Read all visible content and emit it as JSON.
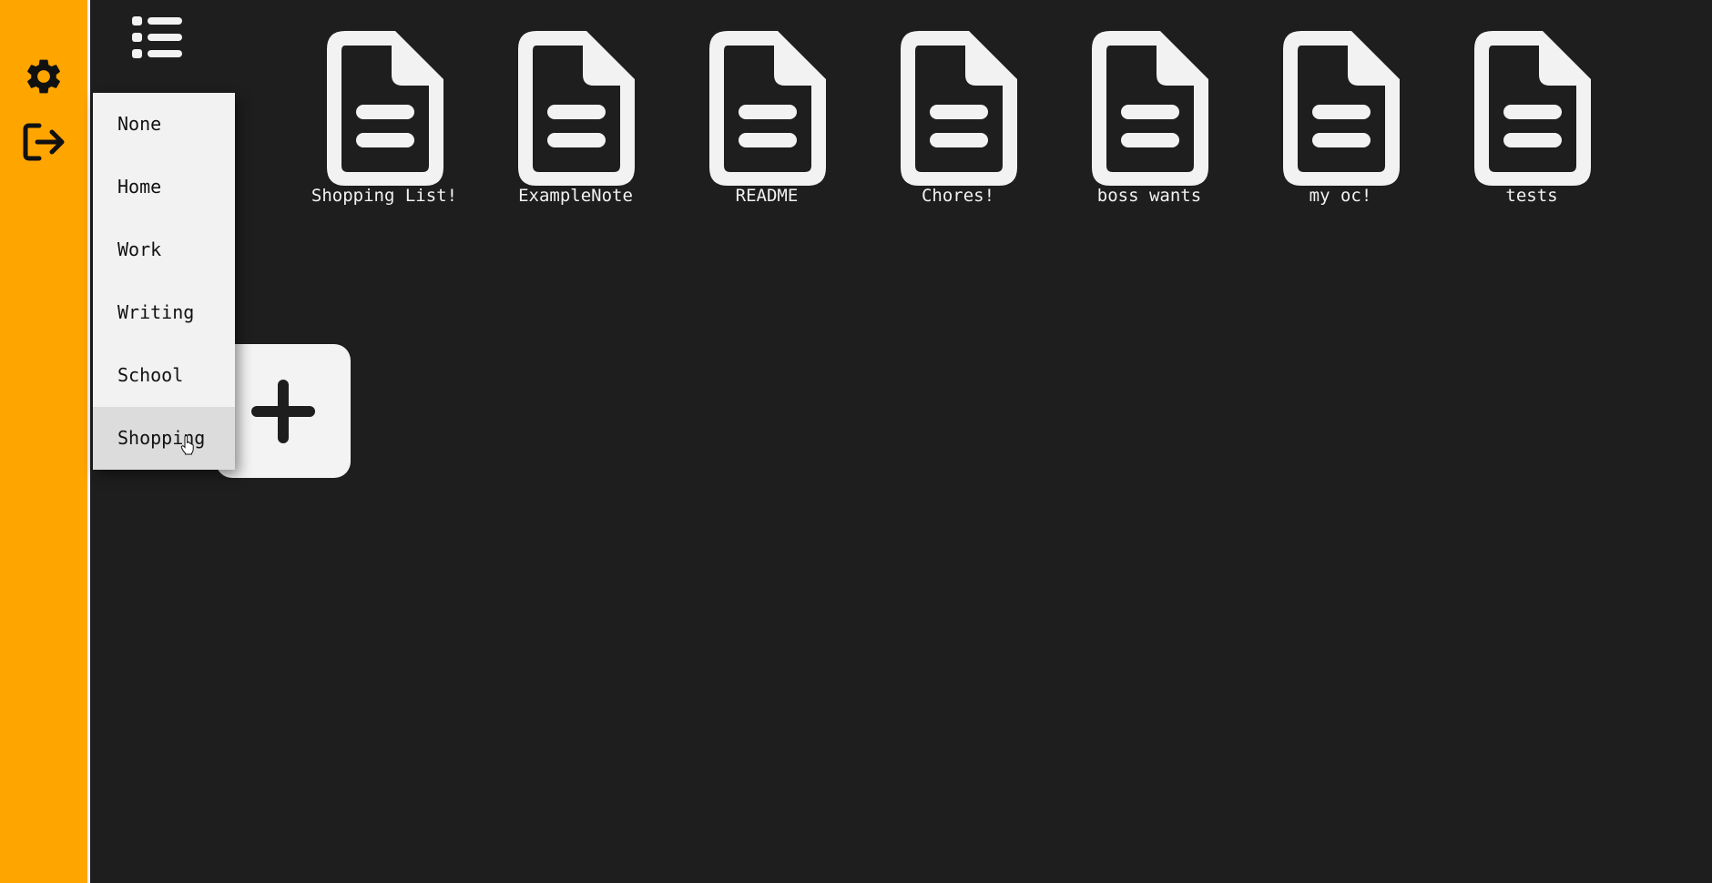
{
  "sidebar": {
    "settings_icon": "gear-icon",
    "logout_icon": "logout-icon",
    "accent_color": "#ffa500"
  },
  "toolbar": {
    "list_toggle_icon": "list-icon"
  },
  "notes": [
    {
      "title": "Shopping List!"
    },
    {
      "title": "ExampleNote"
    },
    {
      "title": "README"
    },
    {
      "title": "Chores!"
    },
    {
      "title": "boss wants"
    },
    {
      "title": "my oc!"
    },
    {
      "title": "tests"
    }
  ],
  "add_button": {
    "icon": "plus-icon"
  },
  "category_menu": {
    "items": [
      {
        "label": "None"
      },
      {
        "label": "Home"
      },
      {
        "label": "Work"
      },
      {
        "label": "Writing"
      },
      {
        "label": "School"
      },
      {
        "label": "Shopping"
      }
    ],
    "hovered": "Shopping"
  }
}
